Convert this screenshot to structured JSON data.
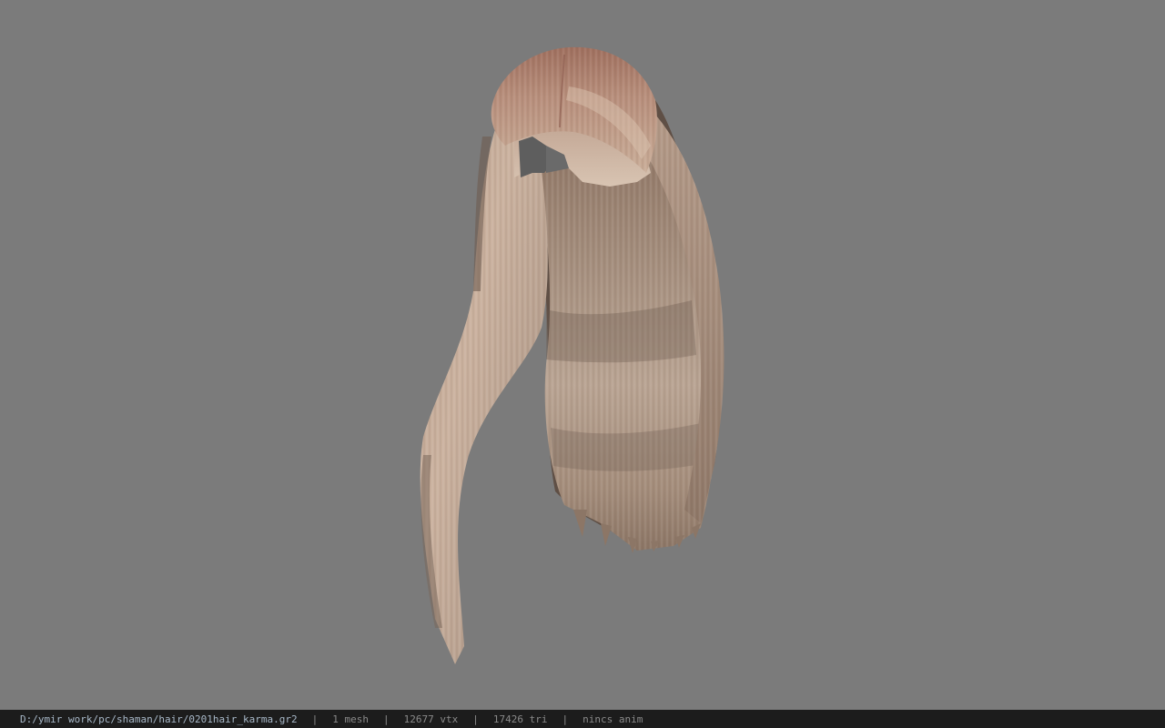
{
  "viewport": {
    "background_color": "#7b7b7b",
    "model_name": "hair-model"
  },
  "status_bar": {
    "file_path": "D:/ymir work/pc/shaman/hair/0201hair_karma.gr2",
    "separator": "|",
    "mesh_count": "1 mesh",
    "vertex_count": "12677 vtx",
    "triangle_count": "17426 tri",
    "anim_status": "nincs anim"
  },
  "colors": {
    "hair_light": "#c9b39f",
    "hair_mid": "#a88f7c",
    "hair_dark": "#6e5a4d",
    "hair_root": "#a8786a",
    "status_bg": "#1c1c1c",
    "status_text": "#8a8a8a",
    "path_text": "#a8b8c8"
  }
}
